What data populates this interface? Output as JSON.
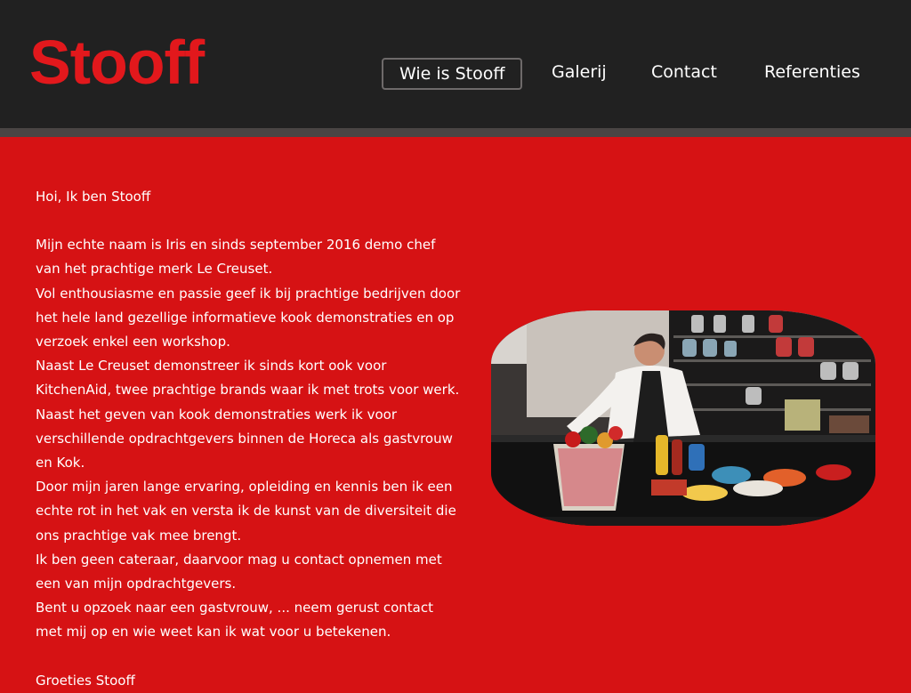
{
  "header": {
    "logo": "Stooff",
    "brand_color": "#e2181c",
    "background_color": "#212121"
  },
  "nav": {
    "items": [
      {
        "label": "Wie is Stooff",
        "active": true
      },
      {
        "label": "Galerij",
        "active": false
      },
      {
        "label": "Contact",
        "active": false
      },
      {
        "label": "Referenties",
        "active": false
      }
    ]
  },
  "main": {
    "background_color": "#d61214",
    "greeting": "Hoi, Ik ben Stooff",
    "paragraphs": [
      "Mijn echte naam is Iris en sinds september 2016 demo chef van het prachtige merk Le Creuset.",
      "Vol enthousiasme en passie geef ik bij prachtige bedrijven door het hele land gezellige informatieve kook demonstraties en op verzoek enkel een workshop.",
      "Naast Le Creuset demonstreer ik sinds kort ook voor KitchenAid, twee prachtige brands waar ik met trots voor werk.",
      "Naast het geven van kook demonstraties werk ik voor verschillende opdrachtgevers binnen de Horeca als gastvrouw en Kok.",
      "Door mijn jaren lange ervaring, opleiding en kennis ben ik een echte rot in het vak en versta ik de kunst van de diversiteit die ons prachtige vak mee brengt.",
      "Ik ben geen cateraar, daarvoor mag u contact opnemen met een van mijn opdrachtgevers.",
      "Bent u opzoek naar een gastvrouw, ... neem gerust contact met mij op en wie weet kan ik wat voor u betekenen."
    ],
    "signoff": "Groeties Stooff"
  }
}
